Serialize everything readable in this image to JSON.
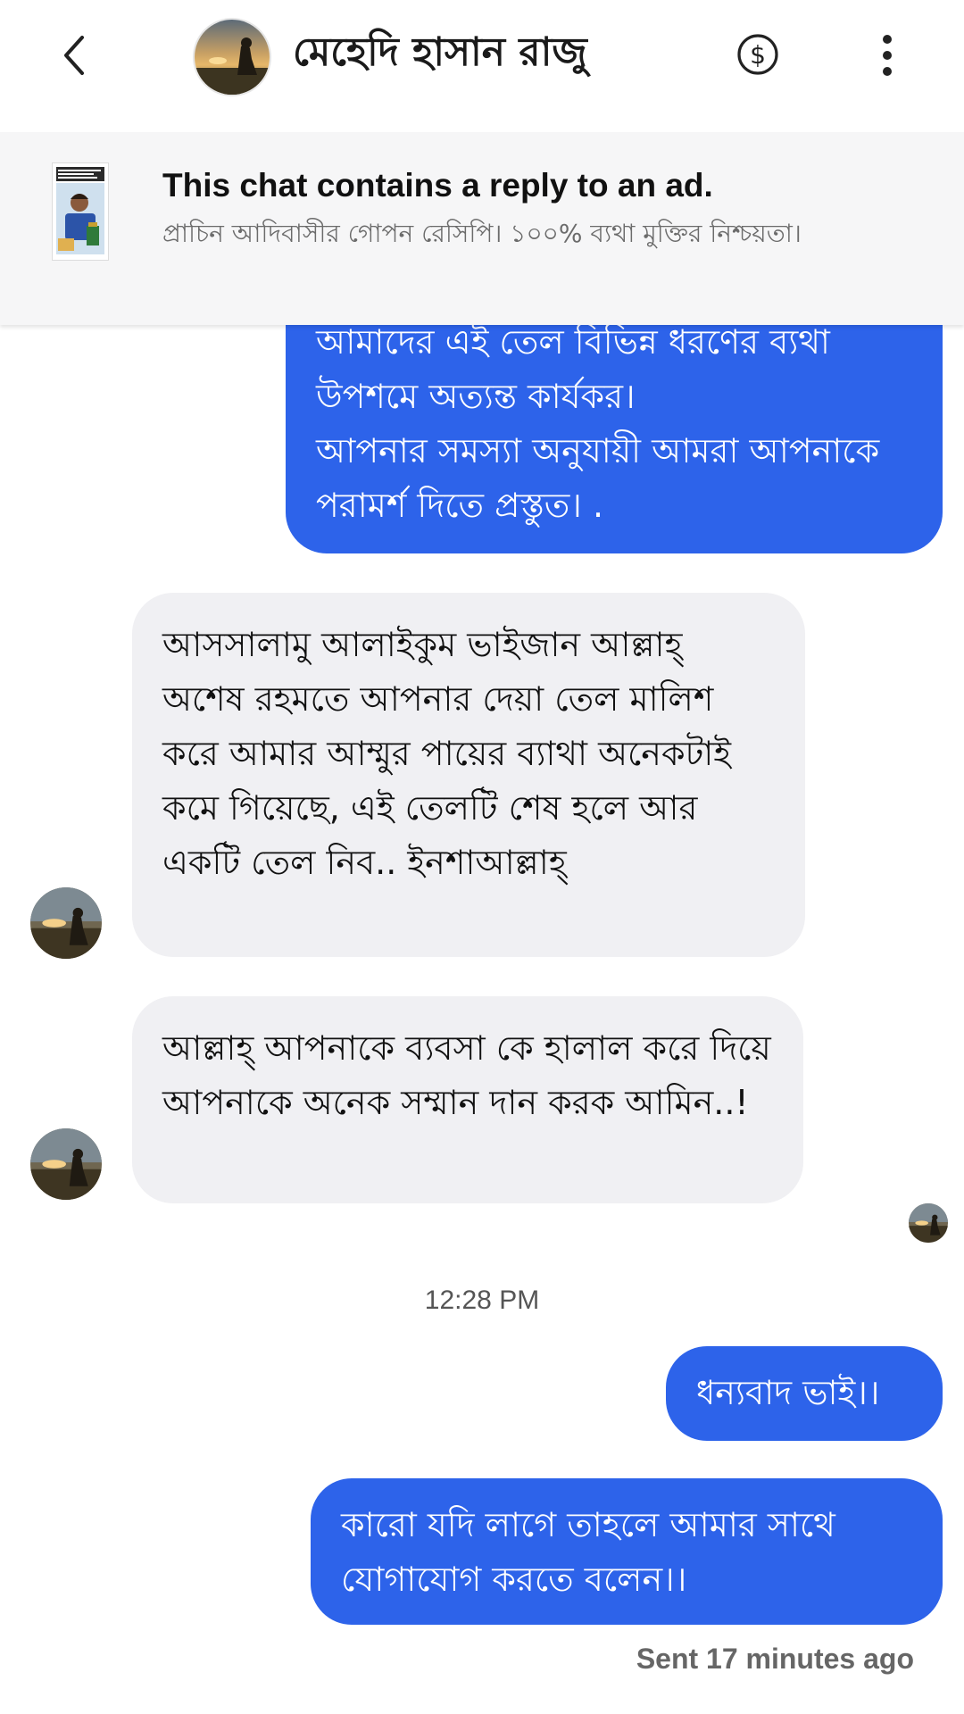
{
  "header": {
    "contact_name": "মেহেদি হাসান রাজু",
    "back_icon": "chevron-left-icon",
    "payment_icon": "dollar-circle-icon",
    "more_icon": "vertical-dots-icon"
  },
  "ad_banner": {
    "title": "This chat contains a reply to an ad.",
    "description": "প্রাচিন আদিবাসীর গোপন রেসিপি। ১০০% ব্যথা মুক্তির নিশ্চয়তা।",
    "close_icon": "close-icon"
  },
  "messages": [
    {
      "direction": "outgoing",
      "text": "আমাদের এই তেল বিভিন্ন ধরণের ব্যথা উপশমে অত্যন্ত কার্যকর।\nআপনার সমস্যা অনুযায়ী আমরা আপনাকে পরামর্শ দিতে প্রস্তুত। ."
    },
    {
      "direction": "incoming",
      "text": "আসসালামু আলাইকুম ভাইজান আল্লাহ্ অশেষ রহমতে আপনার দেয়া তেল মালিশ করে আমার আম্মুর পায়ের ব্যাথা অনেকটাই কমে গিয়েছে, এই তেলটি শেষ হলে আর একটি তেল নিব.. ইনশাআল্লাহ্"
    },
    {
      "direction": "incoming",
      "text": "আল্লাহ্ আপনাকে ব্যবসা কে হালাল করে দিয়ে আপনাকে অনেক সম্মান দান করক আমিন..!"
    },
    {
      "direction": "outgoing",
      "text": "ধন্যবাদ ভাই।।"
    },
    {
      "direction": "outgoing",
      "text": "কারো যদি লাগে তাহলে আমার সাথে যোগাযোগ করতে বলেন।।"
    }
  ],
  "time_divider": "12:28 PM",
  "sent_status": "Sent 17 minutes ago",
  "colors": {
    "outgoing_bubble": "#2d63ea",
    "incoming_bubble": "#f0f0f3",
    "banner_bg": "#f6f6f7"
  }
}
